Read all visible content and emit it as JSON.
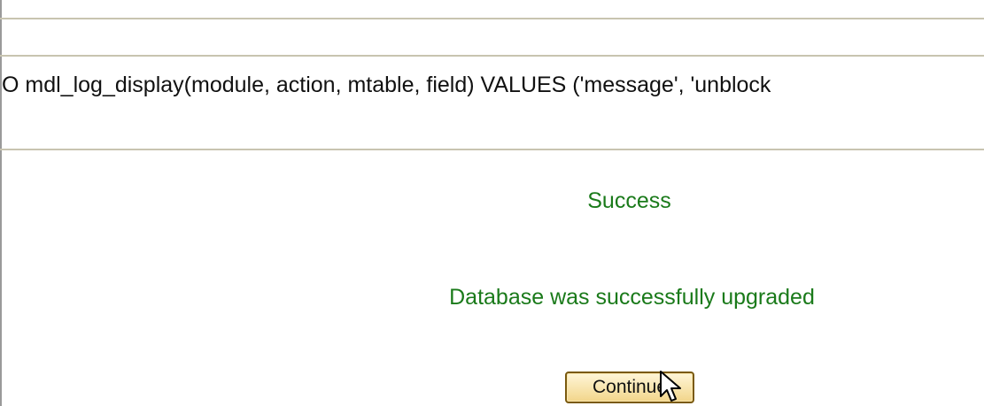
{
  "log": {
    "sql_line": "O mdl_log_display(module, action, mtable, field) VALUES ('message', 'unblock"
  },
  "notifications": {
    "success": "Success",
    "upgraded": "Database was successfully upgraded"
  },
  "actions": {
    "continue_label": "Continue"
  },
  "colors": {
    "notify_success": "#1a7a1a",
    "rule": "#c8c4b0",
    "button_border": "#7a5a10"
  }
}
